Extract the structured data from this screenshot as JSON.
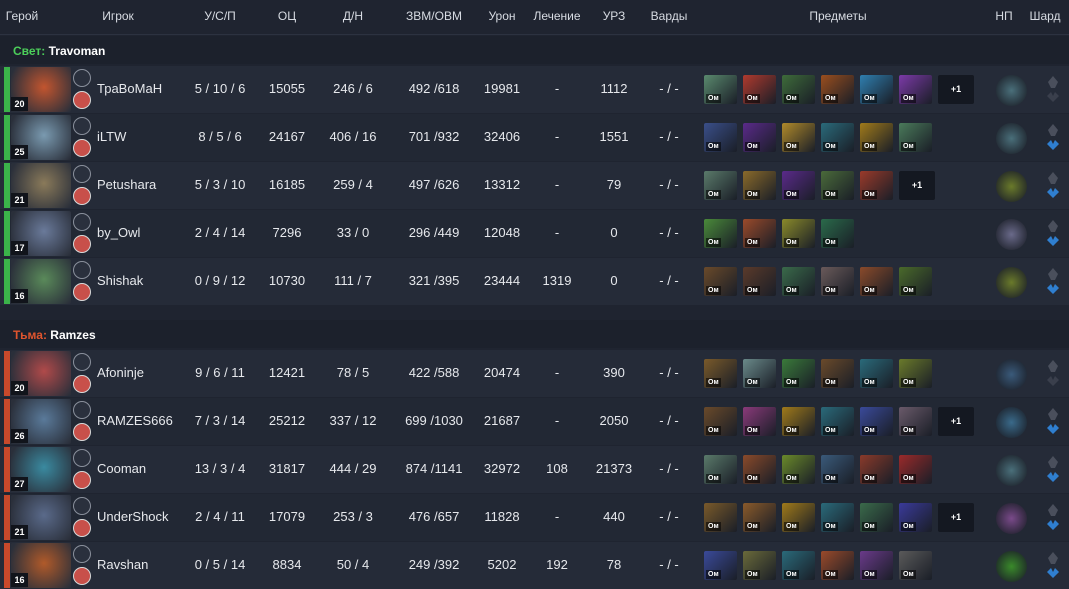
{
  "headers": {
    "hero": "Герой",
    "player": "Игрок",
    "kda": "У/С/П",
    "nw": "ОЦ",
    "lh_dn": "Д/Н",
    "gpm_xpm": "ЗВМ/ОВМ",
    "damage": "Урон",
    "heal": "Лечение",
    "tower": "УРЗ",
    "wards": "Варды",
    "items": "Предметы",
    "np": "НП",
    "shard": "Шард"
  },
  "item_badge": "Ом",
  "colors": {
    "radiant": "#3bb34a",
    "dire": "#c8492b",
    "radiant_label": "#4ccf5a",
    "dire_label": "#e0552e"
  },
  "teams": [
    {
      "side": "Свет:",
      "name": "Travoman",
      "players": [
        {
          "level": "20",
          "name": "ТраВоМаН",
          "kda": "5 / 10 / 6",
          "nw": "15055",
          "lh_dn": "246 / 6",
          "gpm_xpm": "492 /618",
          "damage": "19981",
          "heal": "-",
          "tower": "1112",
          "wards": "- / -",
          "hero_color": "#c2552f",
          "items": [
            "#5a8a6e",
            "#b03a2e",
            "#3e6b3a",
            "#9a4e1e",
            "#2f7fb0",
            "#7c3aa8"
          ],
          "plus": "+1",
          "np_color": "#4a6f7a"
        },
        {
          "level": "25",
          "name": "iLTW",
          "kda": "8 / 5 / 6",
          "nw": "24167",
          "lh_dn": "406 / 16",
          "gpm_xpm": "701 /932",
          "damage": "32406",
          "heal": "-",
          "tower": "1551",
          "wards": "- / -",
          "hero_color": "#7a9ab0",
          "items": [
            "#3a4f8a",
            "#5a2a8a",
            "#b08a2a",
            "#2a6a7a",
            "#a07a1a",
            "#4a7a5a"
          ],
          "plus": "",
          "np_color": "#4a6f7a"
        },
        {
          "level": "21",
          "name": "Petushara",
          "kda": "5 / 3 / 10",
          "nw": "16185",
          "lh_dn": "259 / 4",
          "gpm_xpm": "497 /626",
          "damage": "13312",
          "heal": "-",
          "tower": "79",
          "wards": "- / -",
          "hero_color": "#8a7a5a",
          "items": [
            "#5a7a6a",
            "#8a6a2a",
            "#5a2a8a",
            "#4a6a3a",
            "#9a3a2a"
          ],
          "plus": "+1",
          "np_color": "#6a7a2a"
        },
        {
          "level": "17",
          "name": "by_Owl",
          "kda": "2 / 4 / 14",
          "nw": "7296",
          "lh_dn": "33 / 0",
          "gpm_xpm": "296 /449",
          "damage": "12048",
          "heal": "-",
          "tower": "0",
          "wards": "- / -",
          "hero_color": "#6a7a9a",
          "items": [
            "#4a8a3a",
            "#9a4a2a",
            "#8a8a2a",
            "#2a6a4a"
          ],
          "plus": "",
          "np_color": "#6a6a8a"
        },
        {
          "level": "16",
          "name": "Shishak",
          "kda": "0 / 9 / 12",
          "nw": "10730",
          "lh_dn": "111 / 7",
          "gpm_xpm": "321 /395",
          "damage": "23444",
          "heal": "1319",
          "tower": "0",
          "wards": "- / -",
          "hero_color": "#5a8a5a",
          "items": [
            "#6a4a2a",
            "#5a3a2a",
            "#3a6a4a",
            "#6a5a5a",
            "#8a4a2a",
            "#4a6a2a"
          ],
          "plus": "",
          "np_color": "#6a7a2a"
        }
      ]
    },
    {
      "side": "Тьма:",
      "name": "Ramzes",
      "players": [
        {
          "level": "20",
          "name": "Afoninje",
          "kda": "9 / 6 / 11",
          "nw": "12421",
          "lh_dn": "78 / 5",
          "gpm_xpm": "422 /588",
          "damage": "20474",
          "heal": "-",
          "tower": "390",
          "wards": "- / -",
          "hero_color": "#b04a4a",
          "items": [
            "#7a5a2a",
            "#6a8a8a",
            "#3a7a3a",
            "#6a4a2a",
            "#2a6a7a",
            "#6a7a2a"
          ],
          "plus": "",
          "np_color": "#3a5a7a"
        },
        {
          "level": "26",
          "name": "RAMZES666",
          "kda": "7 / 3 / 14",
          "nw": "25212",
          "lh_dn": "337 / 12",
          "gpm_xpm": "699 /1030",
          "damage": "21687",
          "heal": "-",
          "tower": "2050",
          "wards": "- / -",
          "hero_color": "#5a7a9a",
          "items": [
            "#6a4a2a",
            "#8a3a7a",
            "#a07a1a",
            "#2a6a7a",
            "#3a4a9a",
            "#6a5a6a"
          ],
          "plus": "+1",
          "np_color": "#3a6a8a"
        },
        {
          "level": "27",
          "name": "Cooman",
          "kda": "13 / 3 / 4",
          "nw": "31817",
          "lh_dn": "444 / 29",
          "gpm_xpm": "874 /1141",
          "damage": "32972",
          "heal": "108",
          "tower": "21373",
          "wards": "- / -",
          "hero_color": "#3a8aa0",
          "items": [
            "#5a7a6a",
            "#8a4a2a",
            "#6a8a2a",
            "#3a5a7a",
            "#8a3a2a",
            "#9a2a2a"
          ],
          "plus": "",
          "np_color": "#4a6f7a"
        },
        {
          "level": "21",
          "name": "UnderShock",
          "kda": "2 / 4 / 11",
          "nw": "17079",
          "lh_dn": "253 / 3",
          "gpm_xpm": "476 /657",
          "damage": "11828",
          "heal": "-",
          "tower": "440",
          "wards": "- / -",
          "hero_color": "#5a6a8a",
          "items": [
            "#7a5a2a",
            "#8a5a2a",
            "#a07a1a",
            "#2a6a7a",
            "#3a6a4a",
            "#3a3a9a"
          ],
          "plus": "+1",
          "np_color": "#7a4a8a"
        },
        {
          "level": "16",
          "name": "Ravshan",
          "kda": "0 / 5 / 14",
          "nw": "8834",
          "lh_dn": "50 / 4",
          "gpm_xpm": "249 /392",
          "damage": "5202",
          "heal": "192",
          "tower": "78",
          "wards": "- / -",
          "hero_color": "#b05a2a",
          "items": [
            "#3a4a9a",
            "#6a6a3a",
            "#2a6a7a",
            "#9a4a2a",
            "#6a3a8a",
            "#5a5a5a"
          ],
          "plus": "",
          "np_color": "#3a8a2a"
        }
      ]
    }
  ]
}
